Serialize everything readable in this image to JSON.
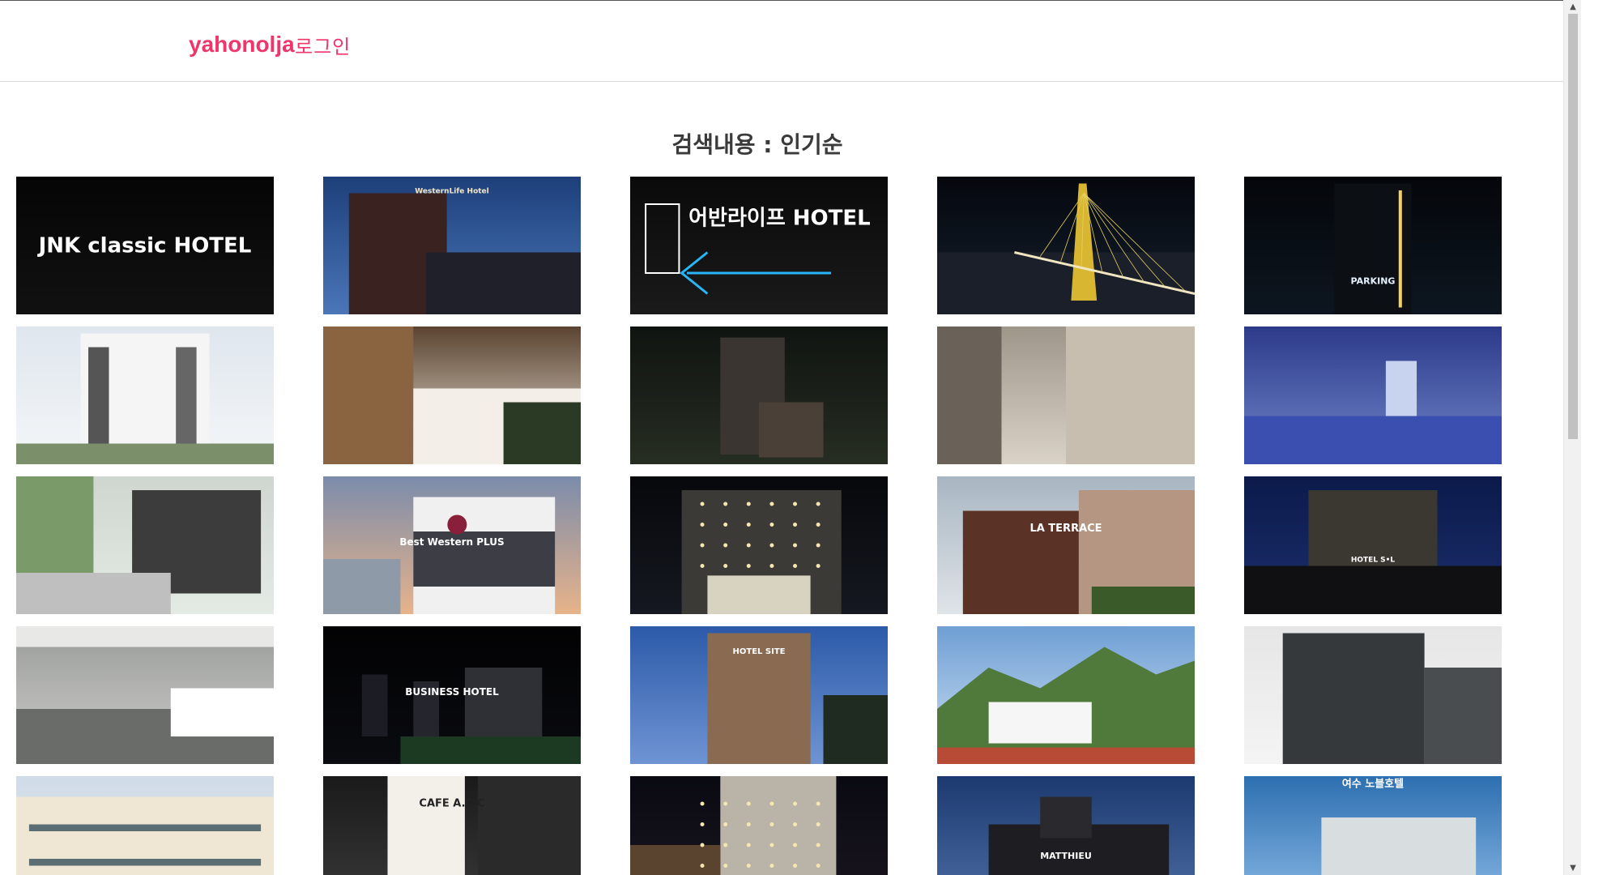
{
  "header": {
    "brand": "yahonolja",
    "login_label": "로그인"
  },
  "search": {
    "heading": "검색내용 : 인기순"
  },
  "hotels": [
    {
      "sign_text": "JNK classic HOTEL",
      "theme": "night-sign"
    },
    {
      "sign_text": "WesternLife Hotel",
      "theme": "dusk-building"
    },
    {
      "sign_text": "어반라이프 HOTEL",
      "theme": "sign-arrow"
    },
    {
      "sign_text": "",
      "theme": "bridge-night"
    },
    {
      "sign_text": "PARKING",
      "theme": "pylon-night"
    },
    {
      "sign_text": "",
      "theme": "white-building"
    },
    {
      "sign_text": "",
      "theme": "lobby"
    },
    {
      "sign_text": "",
      "theme": "aerial-night"
    },
    {
      "sign_text": "",
      "theme": "corridor"
    },
    {
      "sign_text": "",
      "theme": "river-tower"
    },
    {
      "sign_text": "",
      "theme": "garden-path"
    },
    {
      "sign_text": "Best Western PLUS",
      "theme": "bw-plus"
    },
    {
      "sign_text": "",
      "theme": "lit-facade"
    },
    {
      "sign_text": "LA TERRACE",
      "theme": "terrace"
    },
    {
      "sign_text": "HOTEL S•L",
      "theme": "sl-night"
    },
    {
      "sign_text": "",
      "theme": "ev-parking"
    },
    {
      "sign_text": "BUSINESS HOTEL",
      "theme": "dark-city"
    },
    {
      "sign_text": "HOTEL SITE",
      "theme": "site-dusk"
    },
    {
      "sign_text": "",
      "theme": "mountain-resort"
    },
    {
      "sign_text": "",
      "theme": "grey-tower"
    },
    {
      "sign_text": "",
      "theme": "cream-building"
    },
    {
      "sign_text": "CAFE A.C.C",
      "theme": "cafe-sign"
    },
    {
      "sign_text": "",
      "theme": "street-night"
    },
    {
      "sign_text": "MATTHIEU",
      "theme": "matthieu"
    },
    {
      "sign_text": "여수 노블호텔",
      "theme": "noble"
    }
  ],
  "colors": {
    "brand": "#f0356a",
    "heading": "#3a3a3a"
  }
}
